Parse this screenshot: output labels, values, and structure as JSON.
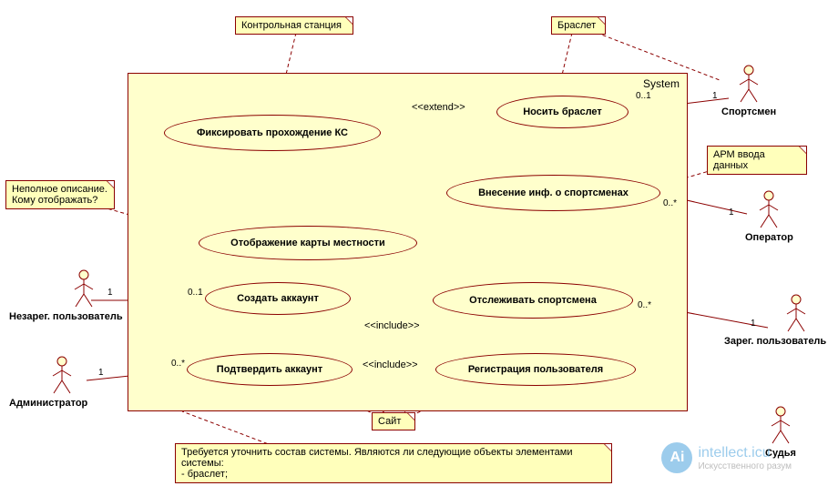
{
  "system_label": "System",
  "notes": {
    "control_station": "Контрольная станция",
    "bracelet": "Браслет",
    "arm_input": "АРМ ввода данных",
    "incomplete": "Неполное описание.\nКому отображать?",
    "site": "Сайт",
    "composition": "Требуется уточнить состав системы. Являются ли следующие объекты элементами системы:\n- браслет;"
  },
  "usecases": {
    "fix_kc": "Фиксировать прохождение КС",
    "wear_bracelet": "Носить браслет",
    "enter_info": "Внесение инф. о спортсменах",
    "show_map": "Отображение карты местности",
    "create_account": "Создать аккаунт",
    "track_athlete": "Отслеживать спортсмена",
    "confirm_account": "Подтвердить аккаунт",
    "register_user": "Регистрация пользователя"
  },
  "actors": {
    "sportsman": "Спортсмен",
    "operator": "Оператор",
    "unreg_user": "Незарег. пользователь",
    "admin": "Администратор",
    "reg_user": "Зарег. пользователь",
    "judge": "Судья"
  },
  "relations": {
    "extend": "<<extend>>",
    "include": "<<include>>"
  },
  "multiplicities": {
    "zero_one": "0..1",
    "one": "1",
    "zero_many": "0..*"
  },
  "watermark": {
    "brand": "intellect.icu",
    "tagline": "Искусственного разум",
    "icon": "Ai"
  },
  "chart_data": {
    "type": "uml_use_case",
    "system": "System",
    "actors": [
      "Спортсмен",
      "Оператор",
      "Незарег. пользователь",
      "Администратор",
      "Зарег. пользователь",
      "Судья"
    ],
    "use_cases": [
      "Фиксировать прохождение КС",
      "Носить браслет",
      "Внесение инф. о спортсменах",
      "Отображение карты местности",
      "Создать аккаунт",
      "Отслеживать спортсмена",
      "Подтвердить аккаунт",
      "Регистрация пользователя"
    ],
    "notes": [
      {
        "text": "Контрольная станция",
        "attached_to": "Фиксировать прохождение КС"
      },
      {
        "text": "Браслет",
        "attached_to": "Носить браслет"
      },
      {
        "text": "АРМ ввода данных",
        "attached_to": "Внесение инф. о спортсменах"
      },
      {
        "text": "Неполное описание. Кому отображать?",
        "attached_to": "Отображение карты местности"
      },
      {
        "text": "Сайт",
        "attached_to": [
          "Создать аккаунт",
          "Подтвердить аккаунт",
          "Отслеживать спортсмена",
          "Регистрация пользователя",
          "Отображение карты местности"
        ]
      },
      {
        "text": "Требуется уточнить состав системы. Являются ли следующие объекты элементами системы: - браслет;",
        "attached_to": "System"
      }
    ],
    "associations": [
      {
        "actor": "Спортсмен",
        "use_case": "Носить браслет",
        "actor_mult": "1",
        "uc_mult": "0..1"
      },
      {
        "actor": "Оператор",
        "use_case": "Внесение инф. о спортсменах",
        "actor_mult": "1",
        "uc_mult": "0..*"
      },
      {
        "actor": "Незарег. пользователь",
        "use_case": "Создать аккаунт",
        "actor_mult": "1",
        "uc_mult": "0..1"
      },
      {
        "actor": "Администратор",
        "use_case": "Подтвердить аккаунт",
        "actor_mult": "1",
        "uc_mult": "0..*"
      },
      {
        "actor": "Зарег. пользователь",
        "use_case": "Отслеживать спортсмена",
        "actor_mult": "1",
        "uc_mult": "0..*"
      },
      {
        "actor": "Судья",
        "use_case": null
      }
    ],
    "dependencies": [
      {
        "from": "Фиксировать прохождение КС",
        "to": "Носить браслет",
        "stereotype": "extend"
      },
      {
        "from": "Регистрация пользователя",
        "to": "Подтвердить аккаунт",
        "stereotype": "include"
      },
      {
        "from": "Регистрация пользователя",
        "to": "Создать аккаунт",
        "stereotype": "include"
      }
    ]
  }
}
